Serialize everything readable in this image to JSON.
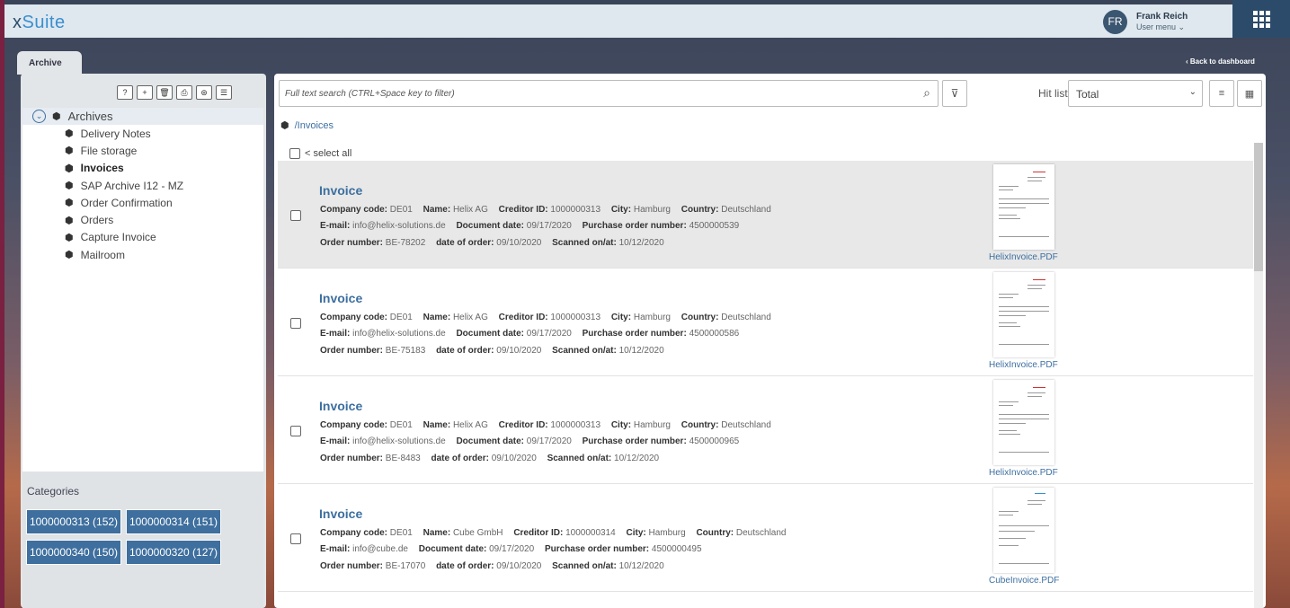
{
  "app": {
    "logo_prefix": "x",
    "logo_main": "Suite"
  },
  "user": {
    "initials": "FR",
    "name": "Frank Reich",
    "menu_label": "User menu ⌄"
  },
  "tabs": [
    {
      "label": "Archive"
    }
  ],
  "back_link": "‹ Back to dashboard",
  "toolbar": {
    "icons": [
      "help-icon",
      "add-icon",
      "delete-icon",
      "print-icon",
      "export-icon",
      "checklist-icon"
    ]
  },
  "tree": {
    "root": "Archives",
    "items": [
      {
        "label": "Delivery Notes"
      },
      {
        "label": "File storage"
      },
      {
        "label": "Invoices",
        "active": true
      },
      {
        "label": "SAP Archive I12 - MZ"
      },
      {
        "label": "Order Confirmation"
      },
      {
        "label": "Orders"
      },
      {
        "label": "Capture Invoice"
      },
      {
        "label": "Mailroom"
      }
    ]
  },
  "categories": {
    "title": "Categories",
    "chips": [
      "1000000313 (152)",
      "1000000314 (151)",
      "1000000340 (150)",
      "1000000320 (127)"
    ]
  },
  "search": {
    "placeholder": "Full text search (CTRL+Space key to filter)"
  },
  "hit_list": {
    "label": "Hit list",
    "value": "Total"
  },
  "path": "/Invoices",
  "select_all": "< select all",
  "labels": {
    "company_code": "Company code:",
    "name": "Name:",
    "creditor_id": "Creditor ID:",
    "city": "City:",
    "country": "Country:",
    "email": "E-mail:",
    "document_date": "Document date:",
    "po_number": "Purchase order number:",
    "order_number": "Order number:",
    "date_of_order": "date of order:",
    "scanned": "Scanned on/at:"
  },
  "results": [
    {
      "title": "Invoice",
      "company_code": "DE01",
      "name": "Helix AG",
      "creditor_id": "1000000313",
      "city": "Hamburg",
      "country": "Deutschland",
      "email": "info@helix-solutions.de",
      "document_date": "09/17/2020",
      "po_number": "4500000539",
      "order_number": "BE-78202",
      "date_of_order": "09/10/2020",
      "scanned": "10/12/2020",
      "file": "HelixInvoice.PDF"
    },
    {
      "title": "Invoice",
      "company_code": "DE01",
      "name": "Helix AG",
      "creditor_id": "1000000313",
      "city": "Hamburg",
      "country": "Deutschland",
      "email": "info@helix-solutions.de",
      "document_date": "09/17/2020",
      "po_number": "4500000586",
      "order_number": "BE-75183",
      "date_of_order": "09/10/2020",
      "scanned": "10/12/2020",
      "file": "HelixInvoice.PDF"
    },
    {
      "title": "Invoice",
      "company_code": "DE01",
      "name": "Helix AG",
      "creditor_id": "1000000313",
      "city": "Hamburg",
      "country": "Deutschland",
      "email": "info@helix-solutions.de",
      "document_date": "09/17/2020",
      "po_number": "4500000965",
      "order_number": "BE-8483",
      "date_of_order": "09/10/2020",
      "scanned": "10/12/2020",
      "file": "HelixInvoice.PDF"
    },
    {
      "title": "Invoice",
      "company_code": "DE01",
      "name": "Cube GmbH",
      "creditor_id": "1000000314",
      "city": "Hamburg",
      "country": "Deutschland",
      "email": "info@cube.de",
      "document_date": "09/17/2020",
      "po_number": "4500000495",
      "order_number": "BE-17070",
      "date_of_order": "09/10/2020",
      "scanned": "10/12/2020",
      "file": "CubeInvoice.PDF"
    }
  ]
}
